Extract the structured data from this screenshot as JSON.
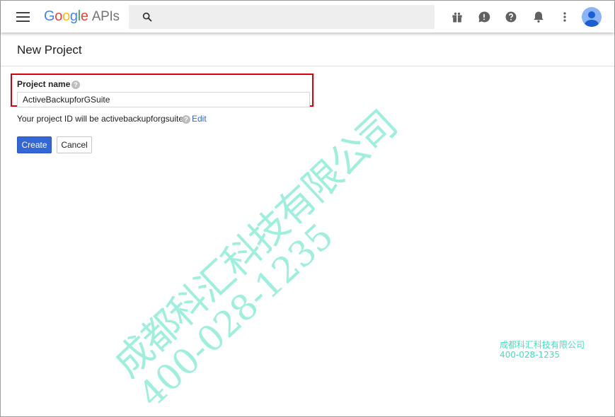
{
  "header": {
    "logo_google": [
      "G",
      "o",
      "o",
      "g",
      "l",
      "e"
    ],
    "logo_apis": "APIs",
    "icons": [
      "menu-icon",
      "search-icon",
      "gift-icon",
      "feedback-icon",
      "help-icon",
      "notifications-icon",
      "more-vert-icon",
      "account-avatar"
    ]
  },
  "page": {
    "title": "New Project"
  },
  "form": {
    "project_name_label": "Project name",
    "project_name_value": "ActiveBackupforGSuite",
    "project_id_text": "Your project ID will be activebackupforgsuite",
    "edit_label": "Edit",
    "create_label": "Create",
    "cancel_label": "Cancel"
  },
  "watermark": {
    "company": "成都科汇科技有限公司",
    "phone": "400-028-1235"
  },
  "colors": {
    "primary": "#3367d6",
    "highlight": "#d9000d",
    "watermark": "#3fe0bf"
  }
}
